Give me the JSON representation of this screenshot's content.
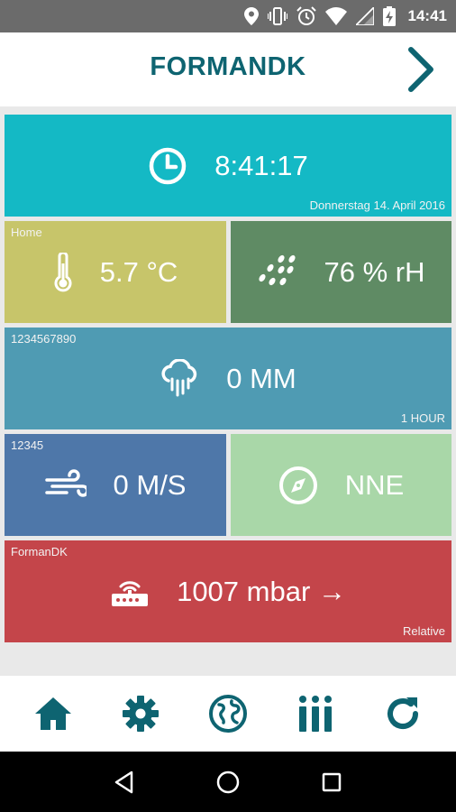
{
  "status_bar": {
    "time": "14:41",
    "icons": [
      "location-icon",
      "vibrate-icon",
      "alarm-icon",
      "wifi-icon",
      "signal-icon",
      "battery-charging-icon"
    ]
  },
  "app_bar": {
    "title": "FORMANDK",
    "next_icon": "chevron-right-icon"
  },
  "colors": {
    "accent": "#0e6471",
    "clock_tile": "#14b9c5",
    "temperature_tile": "#c7c56a",
    "humidity_tile": "#5f8b64",
    "rain_tile": "#4f9bb3",
    "wind_tile": "#4e77a9",
    "direction_tile": "#a9d7a8",
    "pressure_tile": "#c4454a"
  },
  "tiles": {
    "clock": {
      "icon": "clock-icon",
      "value": "8:41:17",
      "date": "Donnerstag 14. April 2016"
    },
    "temperature": {
      "label": "Home",
      "icon": "thermometer-icon",
      "value": "5.7 °C"
    },
    "humidity": {
      "icon": "humidity-icon",
      "value": "76 % rH"
    },
    "rain": {
      "label": "1234567890",
      "icon": "rain-cloud-icon",
      "value": "0 MM",
      "period": "1 HOUR"
    },
    "wind_speed": {
      "label": "12345",
      "icon": "wind-icon",
      "value": "0 M/S"
    },
    "wind_direction": {
      "icon": "compass-icon",
      "value": "NNE"
    },
    "pressure": {
      "label": "FormanDK",
      "icon": "router-icon",
      "value": "1007 mbar →",
      "mode": "Relative"
    }
  },
  "bottom_nav": [
    {
      "name": "home",
      "icon": "home-icon"
    },
    {
      "name": "settings",
      "icon": "gear-icon"
    },
    {
      "name": "globe",
      "icon": "globe-icon"
    },
    {
      "name": "stats",
      "icon": "bars-icon"
    },
    {
      "name": "refresh",
      "icon": "refresh-icon"
    }
  ],
  "system_nav": [
    "back-icon",
    "home-circle-icon",
    "recents-icon"
  ]
}
